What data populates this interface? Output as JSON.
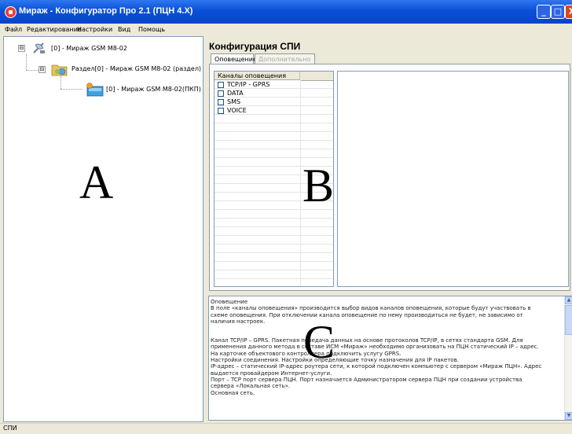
{
  "window": {
    "title": "Мираж - Конфигуратор Про 2.1 (ПЦН 4.X)",
    "minimize": "_",
    "maximize": "□",
    "close": "X"
  },
  "menu": [
    "Файл",
    "Редактирование",
    "Настройки",
    "Вид",
    "Помощь"
  ],
  "tree": {
    "root": {
      "label": "[0] - Мираж GSM M8-02",
      "expander": "⊟"
    },
    "section": {
      "label": "Раздел[0] - Мираж GSM M8-02 (раздел)",
      "expander": "⊟"
    },
    "device": {
      "label": "[0] - Мираж GSM M8-02(ПКП)"
    }
  },
  "config": {
    "title": "Конфигурация СПИ",
    "tabs": [
      "Оповещение",
      "Дополнительно"
    ],
    "channels_header": "Каналы оповещения",
    "channels": [
      {
        "label": "TCP/IP - GPRS",
        "checked": false
      },
      {
        "label": "DATA",
        "checked": false
      },
      {
        "label": "SMS",
        "checked": false
      },
      {
        "label": "VOICE",
        "checked": false
      }
    ]
  },
  "help": {
    "lines": [
      "Оповещение",
      "В поле «каналы оповещения» производится выбор видов каналов оповещения, которые будут участвовать в",
      "схеме оповещения. При отключении канала оповещение по нему производиться не будет, не зависимо от",
      "наличия настроек.",
      "",
      "Канал TCP/IP – GPRS. Пакетная передача данных на основе протоколов TCP/IP, в сетях стандарта GSM. Для",
      "применения данного метода в составе ИСМ «Мираж» необходимо организовать на ПЦН статический IP – адрес.",
      "На карточке объектового контроллера подключить услугу GPRS.",
      "Настройки соединения. Настройки определяющие точку назначения для IP пакетов.",
      "IP-адрес – статический IP-адрес роутера сети, к которой подключен компьютер с сервером «Мираж ПЦН». Адрес",
      "выдается провайдером Интернет-услуги.",
      "Порт – TCP порт сервера ПЦН. Порт назначается Администратором сервера ПЦН при создании устройства",
      "сервера «Локальная сеть».",
      "Основная сеть."
    ]
  },
  "overlay_letters": {
    "a": "A",
    "b": "B",
    "c": "C"
  },
  "status": {
    "text": "СПИ"
  },
  "scroll_arrows": {
    "up": "▲",
    "down": "▼"
  }
}
